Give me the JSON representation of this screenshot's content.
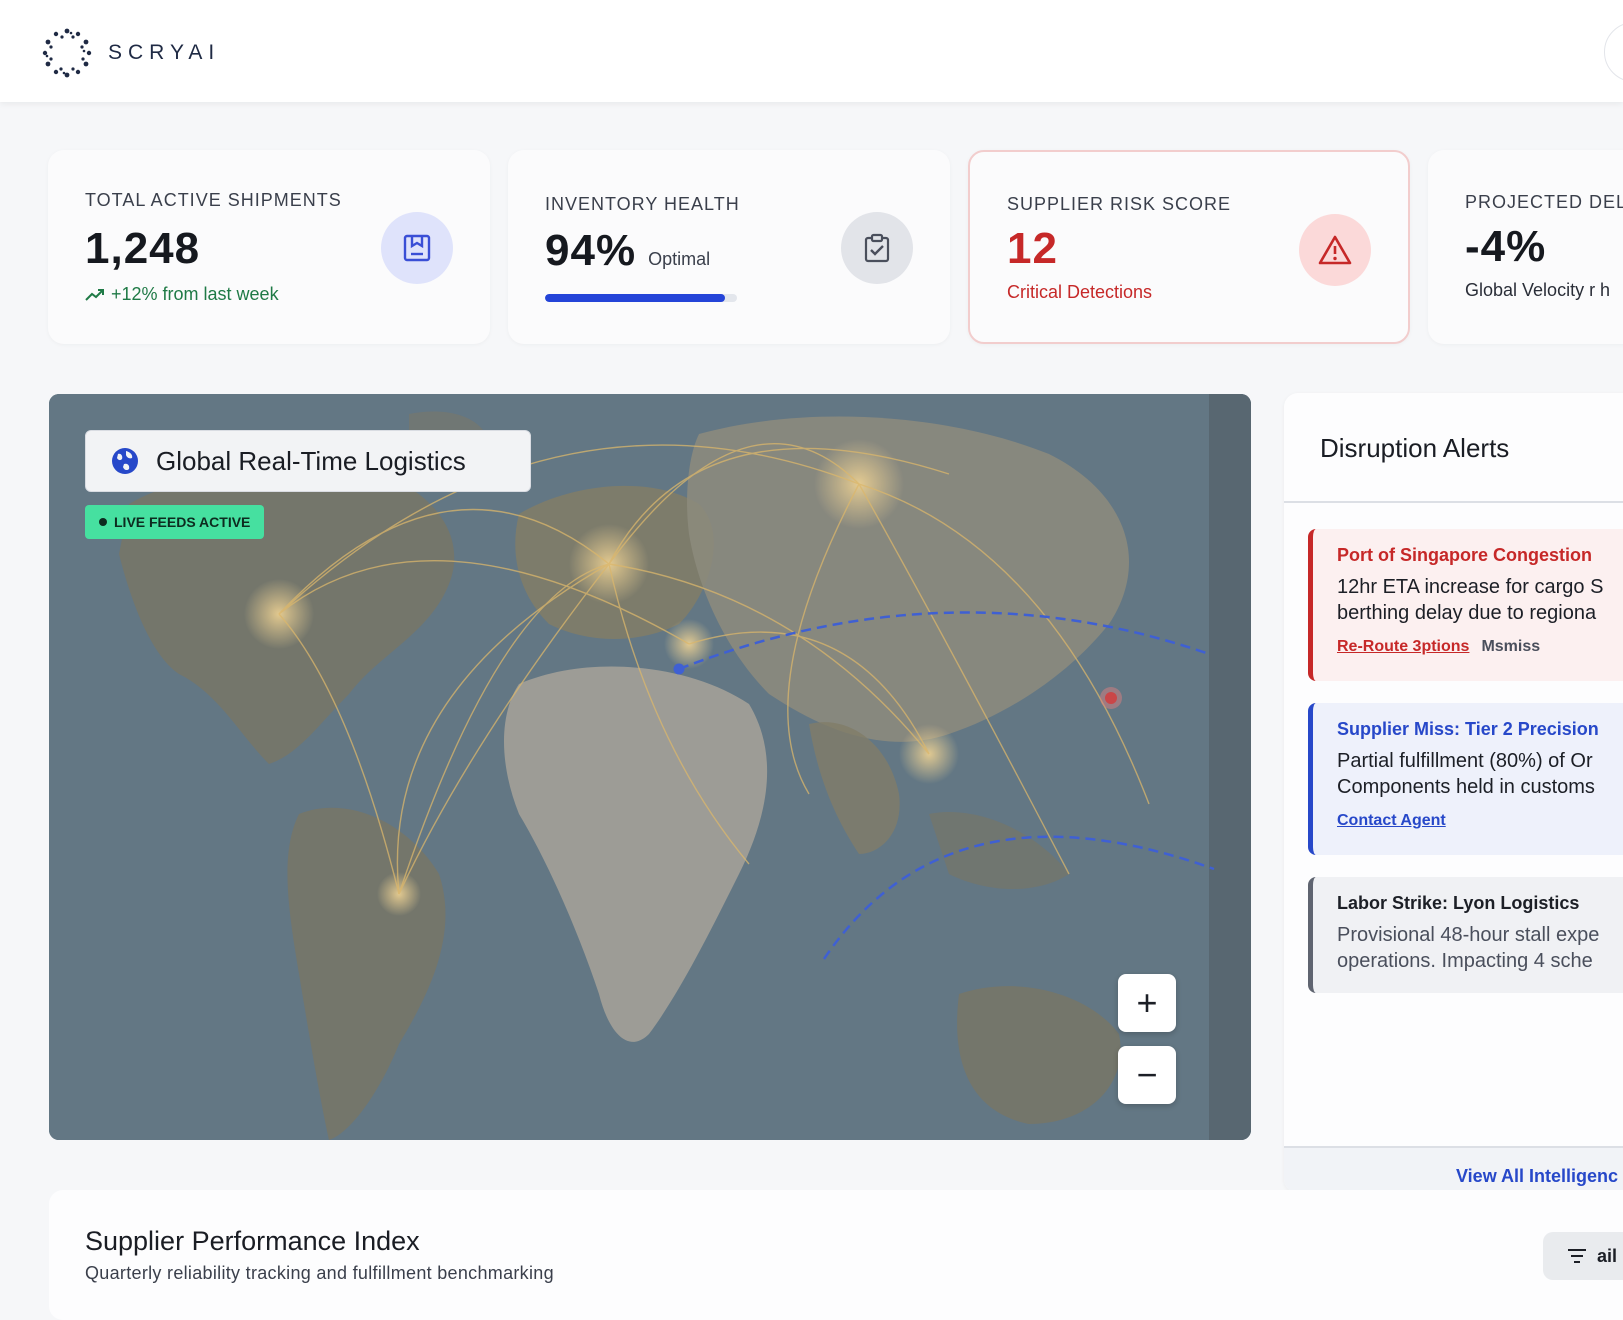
{
  "header": {
    "brand": "SCRYAI"
  },
  "kpis": {
    "shipments": {
      "label": "TOTAL ACTIVE SHIPMENTS",
      "value": "1,248",
      "trend": "+12% from last week",
      "icon": "inventory-box-icon"
    },
    "health": {
      "label": "INVENTORY HEALTH",
      "value": "94%",
      "status": "Optimal",
      "progress": 0.94,
      "icon": "clipboard-check-icon"
    },
    "risk": {
      "label": "SUPPLIER RISK SCORE",
      "value": "12",
      "sub": "Critical Detections",
      "icon": "warning-triangle-icon"
    },
    "delay": {
      "label": "PROJECTED DEL",
      "value": "-4%",
      "sub": "Global Velocity r h"
    }
  },
  "map": {
    "title": "Global Real-Time Logistics",
    "badge": "LIVE FEEDS ACTIVE",
    "zoom_in": "+",
    "zoom_out": "−"
  },
  "alerts": {
    "title": "Disruption Alerts",
    "items": [
      {
        "title": "Port of Singapore Congestion",
        "line1": "12hr ETA increase for cargo S",
        "line2": "berthing delay due to regiona",
        "action1": "Re-Route 3ptions",
        "action2": "Msmiss",
        "accent": "#c62828"
      },
      {
        "title": "Supplier Miss: Tier 2 Precision",
        "line1": "Partial fulfillment (80%) of Or",
        "line2": "Components held in customs",
        "action1": "Contact Agent",
        "accent": "#2748c9"
      },
      {
        "title": "Labor Strike: Lyon Logistics",
        "line1": "Provisional 48-hour stall expe",
        "line2": "operations. Impacting 4 sche",
        "accent": "#5f6470"
      }
    ],
    "footer": "View All Intelligenc"
  },
  "performance": {
    "title": "Supplier Performance Index",
    "subtitle": "Quarterly reliability tracking and fulfillment benchmarking",
    "filter_label": "ail"
  }
}
